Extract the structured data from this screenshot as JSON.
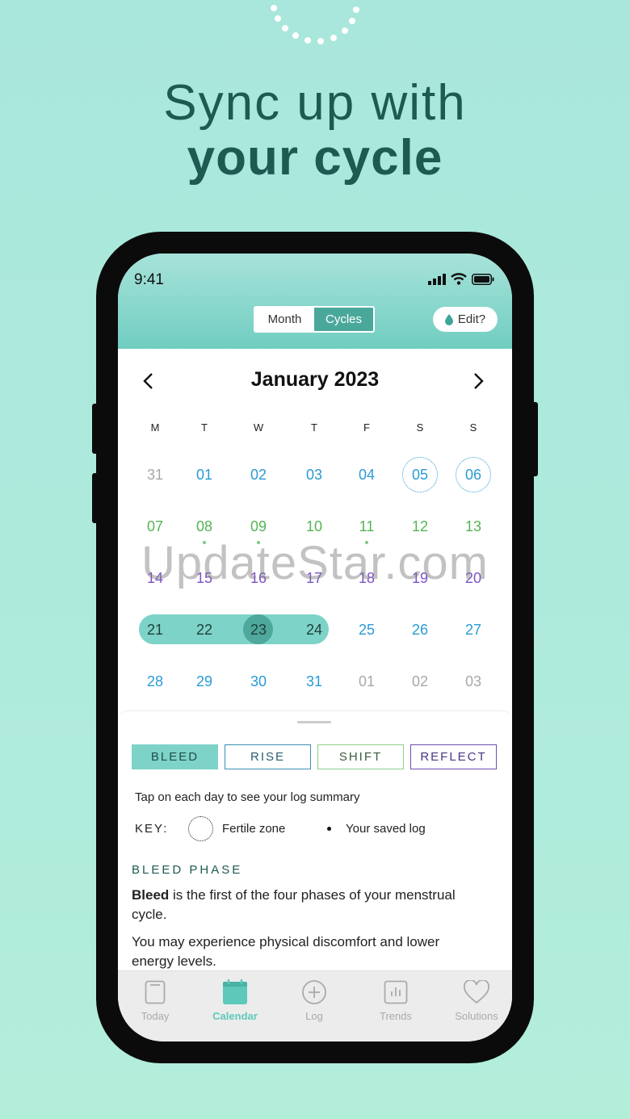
{
  "headline": {
    "line1": "Sync up with",
    "line2": "your cycle"
  },
  "status": {
    "time": "9:41"
  },
  "toggle": {
    "month": "Month",
    "cycles": "Cycles"
  },
  "edit_label": "Edit?",
  "calendar": {
    "title": "January 2023",
    "weekdays": [
      "M",
      "T",
      "W",
      "T",
      "F",
      "S",
      "S"
    ],
    "weeks": [
      [
        {
          "d": "31",
          "c": "#a8a8a8"
        },
        {
          "d": "01",
          "c": "#2a9bd6"
        },
        {
          "d": "02",
          "c": "#2a9bd6"
        },
        {
          "d": "03",
          "c": "#2a9bd6"
        },
        {
          "d": "04",
          "c": "#2a9bd6"
        },
        {
          "d": "05",
          "c": "#2a9bd6",
          "fertile": true
        },
        {
          "d": "06",
          "c": "#2a9bd6",
          "fertile": true
        }
      ],
      [
        {
          "d": "07",
          "c": "#54b454"
        },
        {
          "d": "08",
          "c": "#54b454",
          "dot": true
        },
        {
          "d": "09",
          "c": "#54b454",
          "dot": true
        },
        {
          "d": "10",
          "c": "#54b454"
        },
        {
          "d": "11",
          "c": "#54b454",
          "dot": true
        },
        {
          "d": "12",
          "c": "#54b454"
        },
        {
          "d": "13",
          "c": "#54b454"
        }
      ],
      [
        {
          "d": "14",
          "c": "#7d52c9"
        },
        {
          "d": "15",
          "c": "#7d52c9"
        },
        {
          "d": "16",
          "c": "#7d52c9"
        },
        {
          "d": "17",
          "c": "#7d52c9"
        },
        {
          "d": "18",
          "c": "#7d52c9"
        },
        {
          "d": "19",
          "c": "#7d52c9"
        },
        {
          "d": "20",
          "c": "#7d52c9"
        }
      ],
      [
        {
          "d": "21",
          "c": "#1f3f3b"
        },
        {
          "d": "22",
          "c": "#1f3f3b"
        },
        {
          "d": "23",
          "c": "#1f3f3b"
        },
        {
          "d": "24",
          "c": "#1f3f3b"
        },
        {
          "d": "25",
          "c": "#2a9bd6"
        },
        {
          "d": "26",
          "c": "#2a9bd6"
        },
        {
          "d": "27",
          "c": "#2a9bd6"
        }
      ],
      [
        {
          "d": "28",
          "c": "#2a9bd6"
        },
        {
          "d": "29",
          "c": "#2a9bd6"
        },
        {
          "d": "30",
          "c": "#2a9bd6"
        },
        {
          "d": "31",
          "c": "#2a9bd6"
        },
        {
          "d": "01",
          "c": "#a8a8a8"
        },
        {
          "d": "02",
          "c": "#a8a8a8"
        },
        {
          "d": "03",
          "c": "#a8a8a8"
        }
      ]
    ]
  },
  "phases": {
    "bleed": "BLEED",
    "rise": "RISE",
    "shift": "SHIFT",
    "reflect": "REFLECT"
  },
  "info": {
    "tap_text": "Tap on each day to see your log summary",
    "key_label": "KEY:",
    "fertile_label": "Fertile zone",
    "saved_label": "Your saved log",
    "phase_title": "BLEED PHASE",
    "para1_bold": "Bleed",
    "para1_rest": " is the first of the four phases of your menstrual cycle.",
    "para2": "You may experience physical discomfort and lower energy levels."
  },
  "tabs": {
    "today": "Today",
    "calendar": "Calendar",
    "log": "Log",
    "trends": "Trends",
    "solutions": "Solutions"
  },
  "watermark": "UpdateStar.com",
  "colors": {
    "accent": "#5ec8bb",
    "bleed": "#7dd3c7",
    "rise": "#2a9bd6",
    "shift": "#54b454",
    "reflect": "#7d52c9"
  }
}
